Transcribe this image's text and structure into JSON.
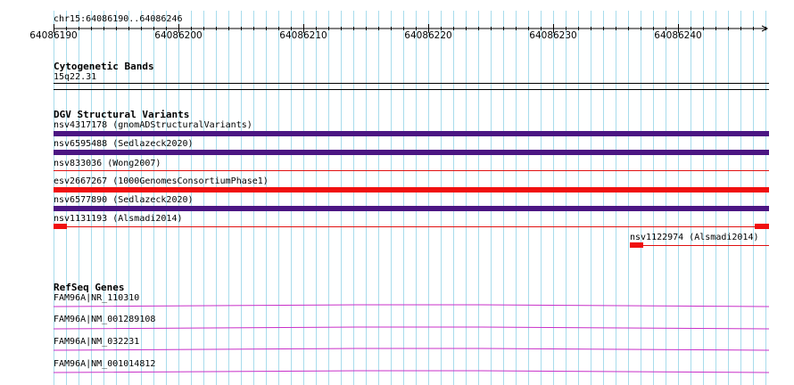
{
  "ruler": {
    "coordinates": "chr15:64086190..64086246",
    "ticks": [
      "64086190",
      "64086200",
      "64086210",
      "64086220",
      "64086230",
      "64086240"
    ]
  },
  "cytoband": {
    "title": "Cytogenetic Bands",
    "band": "15q22.31"
  },
  "dgv": {
    "title": "DGV Structural Variants",
    "variants": [
      {
        "label": "nsv4317178 (gnomADStructuralVariants)",
        "color": "#4b1683"
      },
      {
        "label": "nsv6595488 (Sedlazeck2020)",
        "color": "#4b1683"
      },
      {
        "label": "nsv833036 (Wong2007)",
        "color": "#e01010"
      },
      {
        "label": "esv2667267 (1000GenomesConsortiumPhase1)",
        "color": "#f01010"
      },
      {
        "label": "nsv6577890 (Sedlazeck2020)",
        "color": "#4b1683"
      },
      {
        "label": "nsv1131193 (Alsmadi2014)",
        "color": "#e01010"
      },
      {
        "label": "nsv1122974 (Alsmadi2014)",
        "color": "#e01010"
      }
    ]
  },
  "refseq": {
    "title": "RefSeq Genes",
    "genes": [
      {
        "label": "FAM96A|NR_110310"
      },
      {
        "label": "FAM96A|NM_001289108"
      },
      {
        "label": "FAM96A|NM_032231"
      },
      {
        "label": "FAM96A|NM_001014812"
      }
    ],
    "color": "#c830c8"
  },
  "colors": {
    "grid": "#a8dcec",
    "background": "#ffffff"
  }
}
